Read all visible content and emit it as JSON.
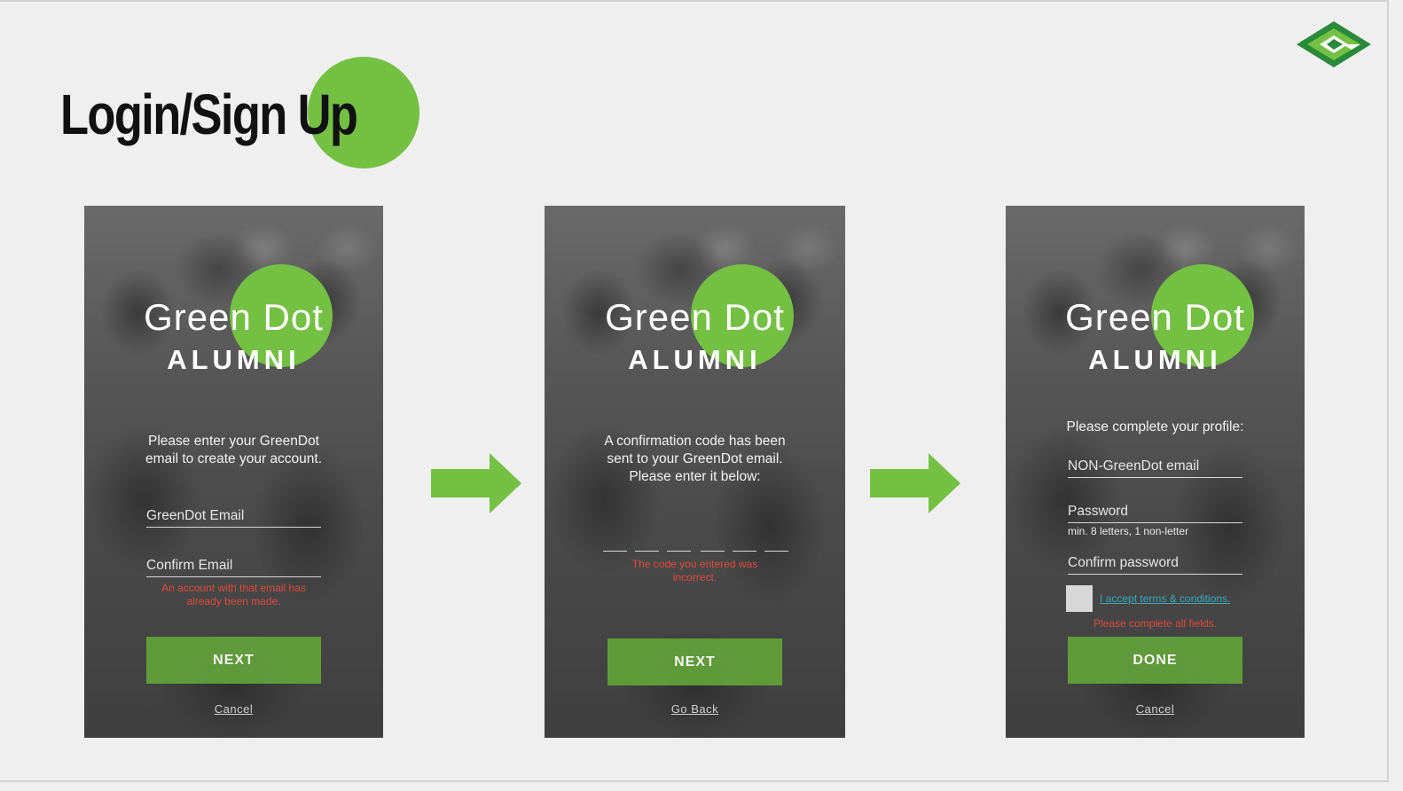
{
  "page": {
    "title": "Login/Sign Up"
  },
  "brand": {
    "name": "Green Dot",
    "subtitle": "ALUMNI",
    "accent": "#74c043"
  },
  "logo": {
    "icon": "green-dot-logo-icon"
  },
  "screen1": {
    "message_line1": "Please enter your GreenDot",
    "message_line2": "email to create your account.",
    "email_placeholder": "GreenDot Email",
    "confirm_placeholder": "Confirm Email",
    "error_line1": "An account with that email has",
    "error_line2": "already been made.",
    "button_label": "NEXT",
    "link_label": "Cancel"
  },
  "screen2": {
    "message_line1": "A confirmation code has been",
    "message_line2": "sent to your GreenDot email.",
    "message_line3": "Please enter it below:",
    "error_line1": "The code you entered was",
    "error_line2": "incorrect.",
    "button_label": "NEXT",
    "link_label": "Go Back"
  },
  "screen3": {
    "message": "Please complete your profile:",
    "email_placeholder": "NON-GreenDot email",
    "password_placeholder": "Password",
    "password_hint": "min. 8 letters, 1 non-letter",
    "confirm_placeholder": "Confirm password",
    "terms_label": "I accept terms & conditions.",
    "error": "Please complete all fields.",
    "button_label": "DONE",
    "link_label": "Cancel"
  },
  "colors": {
    "error": "#e04a3c",
    "link": "#3aa7b8",
    "button": "#62a03a"
  }
}
